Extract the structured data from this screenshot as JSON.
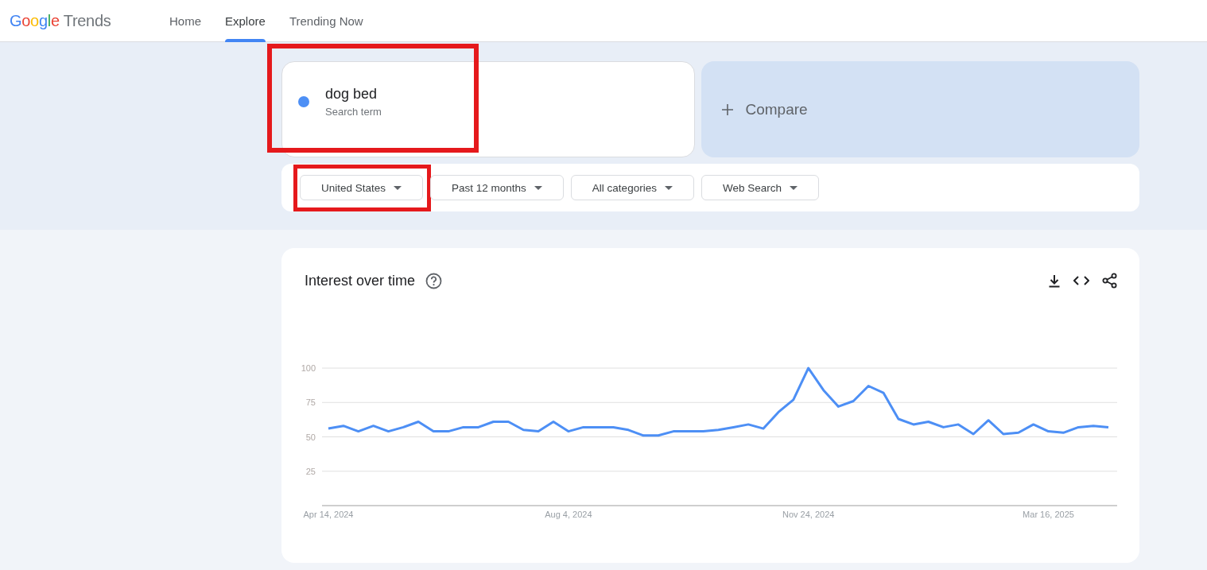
{
  "header": {
    "logo": "Google",
    "product": "Trends",
    "nav": [
      {
        "label": "Home",
        "selected": false
      },
      {
        "label": "Explore",
        "selected": true
      },
      {
        "label": "Trending Now",
        "selected": false
      }
    ]
  },
  "search_term": {
    "term": "dog bed",
    "subtitle": "Search term",
    "color": "#4d8ff5",
    "highlighted": true
  },
  "compare": {
    "label": "Compare"
  },
  "filters": [
    {
      "label": "United States",
      "highlighted": true
    },
    {
      "label": "Past 12 months",
      "highlighted": false
    },
    {
      "label": "All categories",
      "highlighted": false
    },
    {
      "label": "Web Search",
      "highlighted": false
    }
  ],
  "interest_over_time": {
    "title": "Interest over time",
    "chart_data": {
      "type": "line",
      "categories": [
        "Apr 14, 2024",
        null,
        null,
        null,
        null,
        null,
        null,
        null,
        null,
        null,
        null,
        null,
        null,
        null,
        null,
        null,
        "Aug 4, 2024",
        null,
        null,
        null,
        null,
        null,
        null,
        null,
        null,
        null,
        null,
        null,
        null,
        null,
        null,
        null,
        "Nov 24, 2024",
        null,
        null,
        null,
        null,
        null,
        null,
        null,
        null,
        null,
        null,
        null,
        null,
        null,
        null,
        null,
        "Mar 16, 2025",
        null,
        null,
        null,
        null
      ],
      "series": [
        {
          "color": "#4d8ff5",
          "values": [
            56,
            58,
            54,
            58,
            54,
            57,
            61,
            54,
            54,
            57,
            57,
            61,
            61,
            55,
            54,
            61,
            54,
            57,
            57,
            57,
            55,
            51,
            51,
            54,
            54,
            54,
            55,
            57,
            59,
            56,
            68,
            77,
            100,
            84,
            72,
            76,
            87,
            82,
            63,
            59,
            61,
            57,
            59,
            52,
            62,
            52,
            53,
            59,
            54,
            53,
            57,
            58,
            57
          ]
        }
      ],
      "ylim": [
        0,
        100
      ],
      "yticks": [
        25,
        50,
        75,
        100
      ],
      "grid": true
    }
  }
}
